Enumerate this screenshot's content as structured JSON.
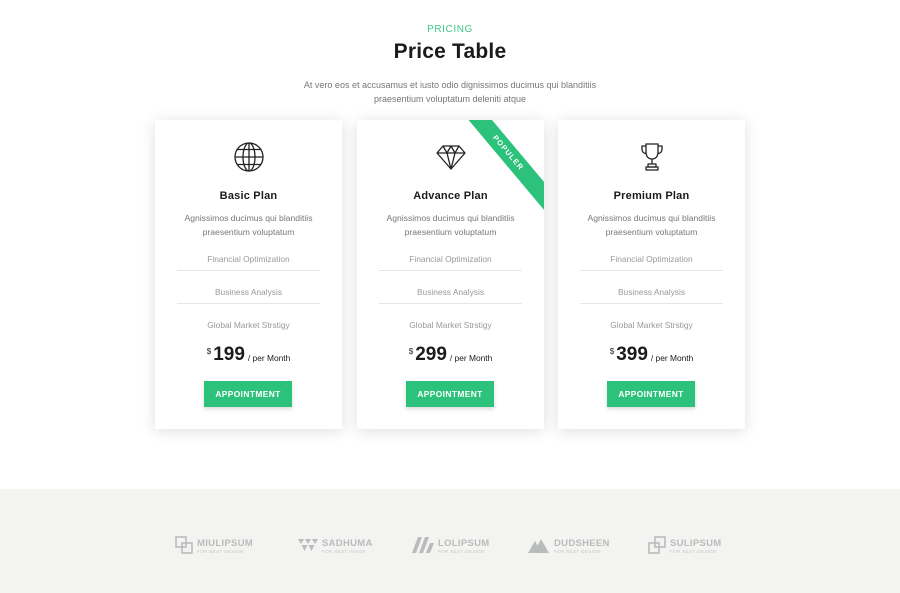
{
  "section": {
    "eyebrow": "PRICING",
    "title": "Price Table",
    "description": "At vero eos et accusamus et iusto odio dignissimos ducimus qui blanditiis praesentium voluptatum deleniti atque"
  },
  "plans": [
    {
      "icon": "globe-icon",
      "name": "Basic Plan",
      "description": "Agnissimos ducimus qui blanditiis praesentium voluptatum",
      "features": [
        "Financial Optimization",
        "Business Analysis",
        "Global Market Strstigy"
      ],
      "currency": "$",
      "amount": "199",
      "period": "/ per Month",
      "button": "APPOINTMENT"
    },
    {
      "icon": "diamond-icon",
      "name": "Advance Plan",
      "description": "Agnissimos ducimus qui blanditiis praesentium voluptatum",
      "features": [
        "Financial Optimization",
        "Business Analysis",
        "Global Market Strstigy"
      ],
      "currency": "$",
      "amount": "299",
      "period": "/ per Month",
      "button": "APPOINTMENT",
      "ribbon": "POPULER"
    },
    {
      "icon": "trophy-icon",
      "name": "Premium Plan",
      "description": "Agnissimos ducimus qui blanditiis praesentium voluptatum",
      "features": [
        "Financial Optimization",
        "Business Analysis",
        "Global Market Strstigy"
      ],
      "currency": "$",
      "amount": "399",
      "period": "/ per Month",
      "button": "APPOINTMENT"
    }
  ],
  "brands": [
    {
      "name": "MIULIPSUM",
      "tag": "FOR BEST DESIGN",
      "icon": "squares-logo-icon"
    },
    {
      "name": "SADHUMA",
      "tag": "FOR BEST IMAGE",
      "icon": "triangles-logo-icon"
    },
    {
      "name": "LOLIPSUM",
      "tag": "FOR BEST DESIGN",
      "icon": "m-logo-icon"
    },
    {
      "name": "DUDSHEEN",
      "tag": "FOR BEST DESIGN",
      "icon": "peaks-logo-icon"
    },
    {
      "name": "SULIPSUM",
      "tag": "FOR BEST DESIGN",
      "icon": "squares-logo-icon"
    }
  ],
  "colors": {
    "accent": "#2dc27c",
    "eyebrow": "#3cc98a",
    "brand_bar_bg": "#f3f4f2"
  }
}
